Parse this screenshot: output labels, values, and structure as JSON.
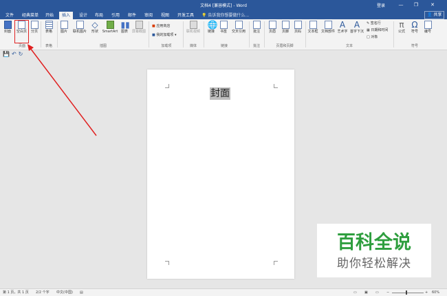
{
  "window": {
    "title": "文档4 [兼容模式] - Word",
    "login": "登录",
    "minimize_icon": "—",
    "restore_icon": "❐",
    "close_icon": "✕"
  },
  "tabs": [
    "文件",
    "经典菜单",
    "开始",
    "插入",
    "设计",
    "布局",
    "引用",
    "邮件",
    "审阅",
    "视图",
    "开发工具"
  ],
  "active_tab": "插入",
  "search": {
    "placeholder": "告诉我你想要做什么..."
  },
  "share": "共享",
  "ribbon": {
    "pages": {
      "cover": "封面",
      "blank": "空白页",
      "break": "分页",
      "group": "页面"
    },
    "tables": {
      "table": "表格",
      "group": "表格"
    },
    "illustrations": {
      "picture": "图片",
      "online_picture": "联机图片",
      "shapes": "形状",
      "smartart": "SmartArt",
      "chart": "图表",
      "screenshot": "屏幕截图",
      "group": "插图"
    },
    "addins": {
      "store": "应用商店",
      "my_addins": "我的加载项",
      "group": "加载项"
    },
    "media": {
      "online_video": "联机视频",
      "group": "媒体"
    },
    "links": {
      "link": "链接",
      "bookmark": "书签",
      "cross_ref": "交叉引用",
      "group": "链接"
    },
    "comments": {
      "comment": "批注",
      "group": "批注"
    },
    "header_footer": {
      "header": "页眉",
      "footer": "页脚",
      "page_number": "页码",
      "group": "页眉和页脚"
    },
    "text": {
      "textbox": "文本框",
      "quick_parts": "文档部件",
      "wordart": "艺术字",
      "dropcap": "首字下沉",
      "signature": "签名行",
      "datetime": "日期和时间",
      "object": "对象",
      "group": "文本"
    },
    "symbols": {
      "equation": "公式",
      "symbol": "符号",
      "number": "编号",
      "group": "符号"
    }
  },
  "document": {
    "text": "封面"
  },
  "status": {
    "page": "第 1 页，共 1 页",
    "words": "2/2 个字",
    "language": "中文(中国)",
    "zoom": "60%"
  },
  "watermark": {
    "line1": "百科全说",
    "line2": "助你轻松解决"
  }
}
